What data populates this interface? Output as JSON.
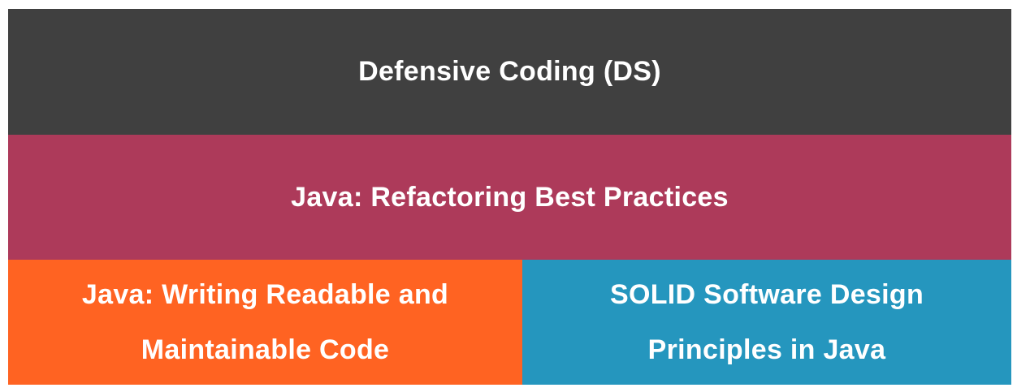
{
  "blocks": {
    "top": {
      "label": "Defensive Coding (DS)",
      "color": "#404040"
    },
    "middle": {
      "label": "Java: Refactoring Best Practices",
      "color": "#ad3a5a"
    },
    "left": {
      "line1": "Java: Writing Readable and",
      "line2": "Maintainable Code",
      "color": "#ff6322"
    },
    "right": {
      "line1": "SOLID Software Design",
      "line2": "Principles in Java",
      "color": "#2596be"
    }
  }
}
